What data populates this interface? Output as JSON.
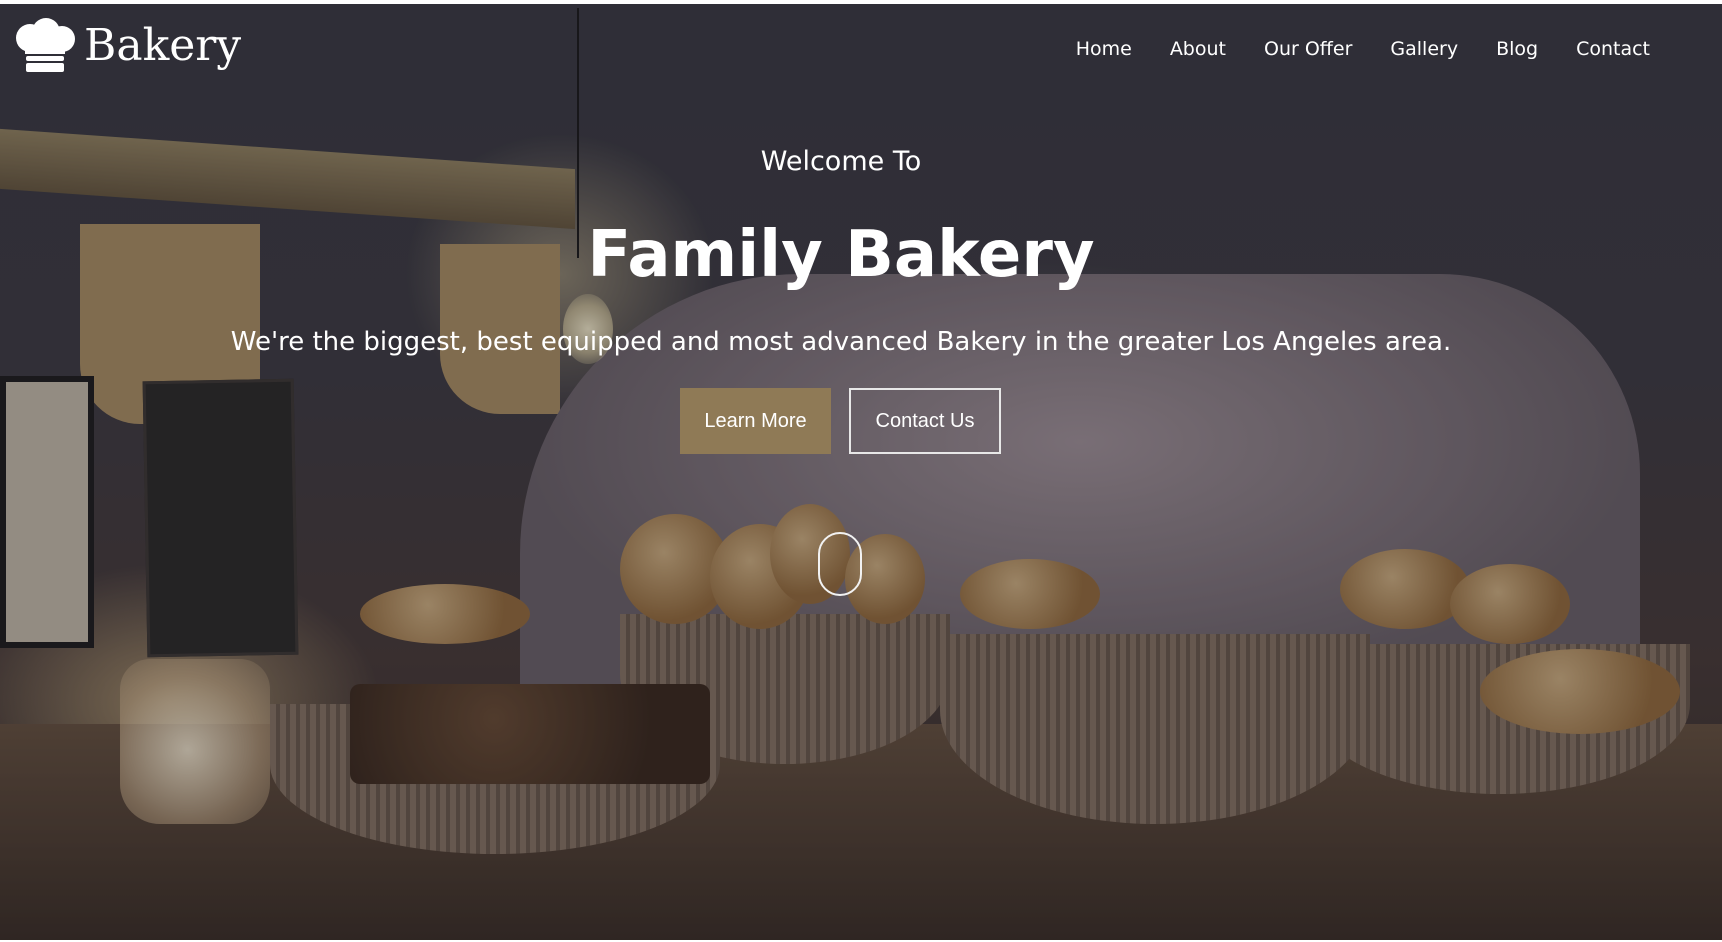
{
  "brand": {
    "name": "Bakery",
    "logo_icon": "chef-hat-icon"
  },
  "nav": {
    "items": [
      {
        "label": "Home"
      },
      {
        "label": "About"
      },
      {
        "label": "Our Offer"
      },
      {
        "label": "Gallery"
      },
      {
        "label": "Blog"
      },
      {
        "label": "Contact"
      }
    ]
  },
  "hero": {
    "welcome": "Welcome To",
    "title": "Family Bakery",
    "subtitle": "We're the biggest, best equipped and most advanced Bakery in the greater Los Angeles area.",
    "learn_more_label": "Learn More",
    "contact_label": "Contact Us",
    "scroll_icon": "mouse-scroll-icon"
  },
  "colors": {
    "accent": "#8f7a56",
    "text": "#ffffff"
  }
}
